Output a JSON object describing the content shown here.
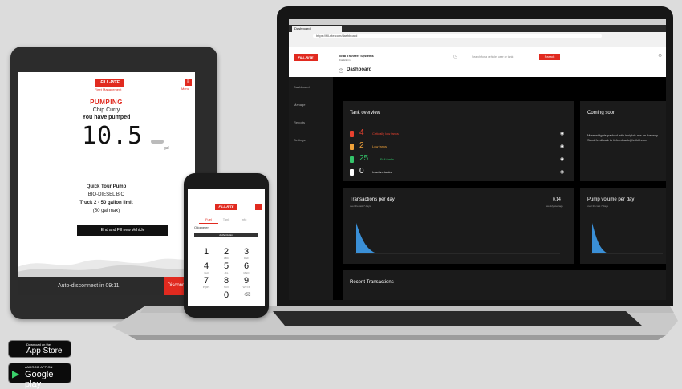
{
  "tablet": {
    "status": "PUMPING",
    "customer": "Chip Curry",
    "pumped_label": "You have pumped",
    "volume": "10.5",
    "unit": "gal",
    "pump_name": "Quick Tour Pump",
    "fuel": "BIO-DIESEL BIO",
    "limit": "Truck 2 - 50 gallon limit",
    "max": "(50 gal max)",
    "action_button": "End and Fill new Vehicle",
    "auto_disconnect": "Auto-disconnect in 09:11",
    "disconnect_button": "Disconnect",
    "logo": "FILL-RITE",
    "logo_sub": "Fleet Management",
    "menu_label": "Menu"
  },
  "phone": {
    "logo": "FILL-RITE",
    "tabs": [
      "Fuel",
      "Tank",
      "Info"
    ],
    "field_label": "Odometer",
    "button": "Authorization",
    "keys": [
      {
        "n": "1",
        "l": ""
      },
      {
        "n": "2",
        "l": "ABC"
      },
      {
        "n": "3",
        "l": "DEF"
      },
      {
        "n": "4",
        "l": "GHI"
      },
      {
        "n": "5",
        "l": "JKL"
      },
      {
        "n": "6",
        "l": "MNO"
      },
      {
        "n": "7",
        "l": "PQRS"
      },
      {
        "n": "8",
        "l": "TUV"
      },
      {
        "n": "9",
        "l": "WXYZ"
      },
      {
        "n": "0",
        "l": ""
      }
    ]
  },
  "laptop": {
    "browser_tab": "Dashboard",
    "url": "https://fill-rite.com/dashboard",
    "company": "Total Transfer Systems",
    "user": "Bria Ellerin",
    "search_placeholder": "Search for a vehicle, user or tank",
    "search_button": "Search",
    "page_title": "Dashboard",
    "logo": "FILL-RITE",
    "sidebar": [
      "Dashboard",
      "Manage",
      "Reports",
      "Settings"
    ],
    "tank_overview": {
      "title": "Tank overview",
      "rows": [
        {
          "count": "4",
          "label": "Critically low tanks",
          "color": "#e8412f"
        },
        {
          "count": "2",
          "label": "Low tanks",
          "color": "#f0a23a"
        },
        {
          "count": "25",
          "label": "Full tanks",
          "color": "#33c46a"
        },
        {
          "count": "0",
          "label": "Inactive tanks",
          "color": "#ffffff"
        }
      ]
    },
    "coming_soon": {
      "title": "Coming soon",
      "text": "More widgets packed with insights are on the way. Send feedback to fr-feedback@tuthill.com"
    },
    "transactions": {
      "title": "Transactions per day",
      "subtitle": "over the last 7 days",
      "value": "0.14",
      "value_label": "weekly average"
    },
    "pump_volume": {
      "title": "Pump volume per day",
      "subtitle": "over the last 7 days"
    },
    "recent": {
      "title": "Recent Transactions"
    }
  },
  "badges": {
    "app_store_top": "Download on the",
    "app_store": "App Store",
    "google_top": "ANDROID APP ON",
    "google": "Google play"
  }
}
